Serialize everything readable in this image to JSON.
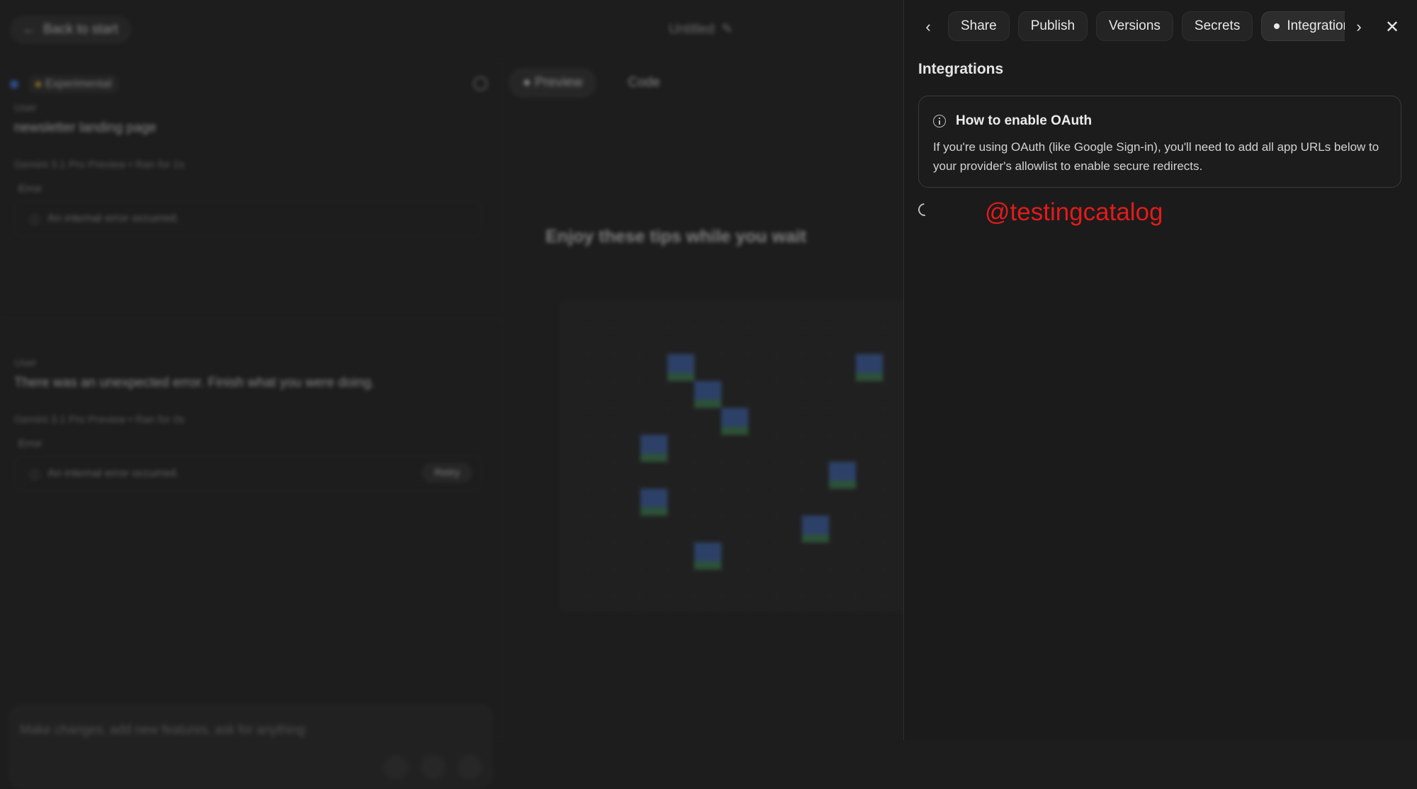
{
  "background": {
    "back_button": "Back to start",
    "doc_title": "Untitled",
    "model_chip": "Experimental",
    "messages": [
      {
        "role": "User",
        "text": "newsletter landing page",
        "meta": "Gemini 3.1 Pro Preview  •  Ran for 1s",
        "error_label": "Error",
        "error_text": "An internal error occurred."
      },
      {
        "role": "User",
        "text": "There was an unexpected error. Finish what you were doing.",
        "meta": "Gemini 3.1 Pro Preview  •  Ran for 0s",
        "error_label": "Error",
        "error_text": "An internal error occurred.",
        "retry": "Retry"
      }
    ],
    "composer_placeholder": "Make changes, add new features, ask for anything",
    "view_tabs": {
      "preview": "Preview",
      "code": "Code"
    },
    "tips_heading": "Enjoy these tips while you wait"
  },
  "drawer": {
    "tabs": [
      {
        "label": "Share",
        "active": false
      },
      {
        "label": "Publish",
        "active": false
      },
      {
        "label": "Versions",
        "active": false
      },
      {
        "label": "Secrets",
        "active": false
      },
      {
        "label": "Integrations",
        "active": true
      }
    ],
    "title": "Integrations",
    "info": {
      "title": "How to enable OAuth",
      "body": "If you're using OAuth (like Google Sign-in), you'll need to add all app URLs below to your provider's allowlist to enable secure redirects."
    }
  },
  "watermark": "@testingcatalog",
  "colors": {
    "watermark": "#e21b1b",
    "accent_blue": "#3b6fd8"
  }
}
